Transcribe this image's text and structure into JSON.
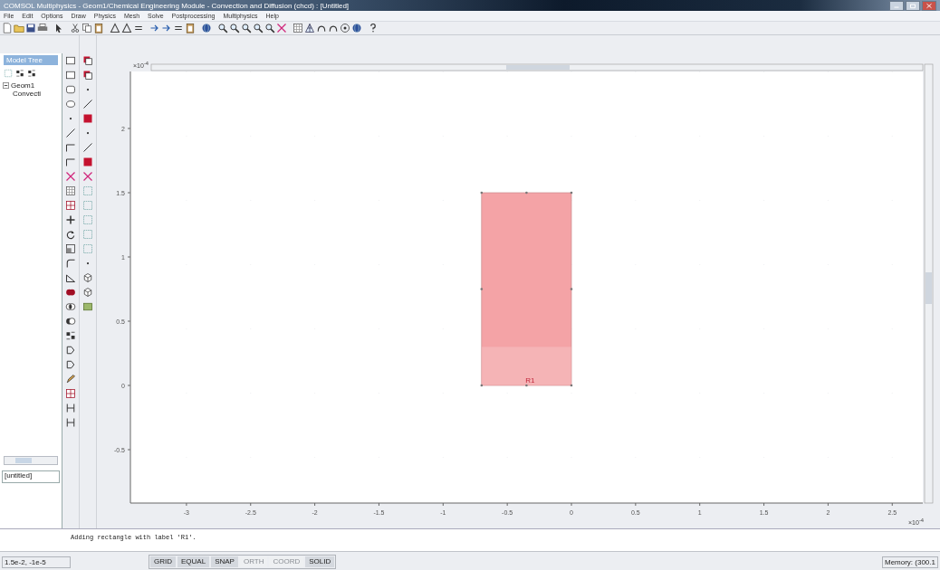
{
  "window": {
    "title": "COMSOL Multiphysics - Geom1/Chemical Engineering Module - Convection and Diffusion (chcd) : [Untitled]"
  },
  "menu": [
    "File",
    "Edit",
    "Options",
    "Draw",
    "Physics",
    "Mesh",
    "Solve",
    "Postprocessing",
    "Multiphysics",
    "Help"
  ],
  "model_tree": {
    "header": "Model Tree",
    "items": [
      {
        "label": "Geom1",
        "expanded": true,
        "children": [
          {
            "label": "Convecti"
          }
        ]
      }
    ],
    "field": "[untitled]"
  },
  "geometry": {
    "x_ticks": [
      "-3",
      "-2.5",
      "-2",
      "-1.5",
      "-1",
      "-0.5",
      "0",
      "0.5",
      "1",
      "1.5",
      "2",
      "2.5"
    ],
    "y_ticks": [
      "2",
      "1.5",
      "1",
      "0.5",
      "0",
      "-0.5"
    ],
    "x_scale": "×10$^{-4}$",
    "y_scale": "×10$^{-4}$",
    "objects": [
      {
        "label": "R1"
      }
    ]
  },
  "message": "Adding rectangle with label 'R1'.",
  "status_bar": {
    "coordinates": "1.5e-2, -1e-5",
    "toggles": [
      {
        "label": "GRID",
        "on": true
      },
      {
        "label": "EQUAL",
        "on": true
      },
      {
        "label": "SNAP",
        "on": true
      },
      {
        "label": "ORTH",
        "on": false
      },
      {
        "label": "COORD",
        "on": false
      },
      {
        "label": "SOLID",
        "on": true
      }
    ],
    "memory": "Memory: (300.1"
  }
}
